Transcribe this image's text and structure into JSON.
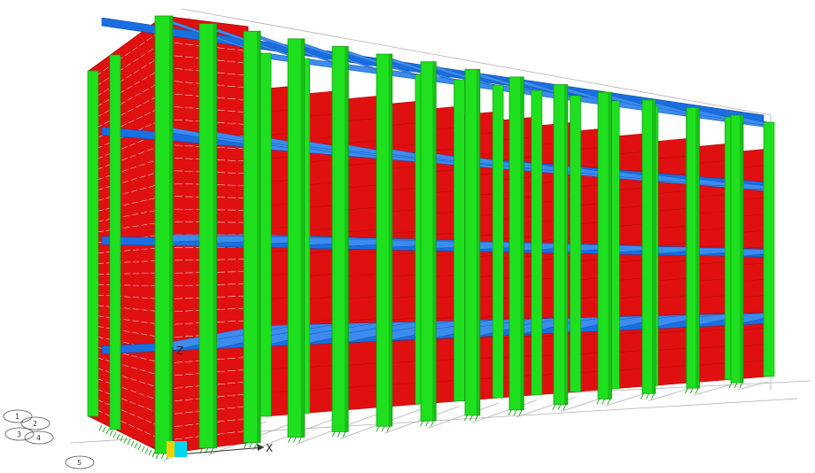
{
  "viewport": {
    "title": "",
    "background": "#ffffff"
  },
  "model": {
    "colors": {
      "columns": "#1fe01f",
      "column_dark": "#10a010",
      "beams": "#1a6ee0",
      "beams_light": "#3c8cf0",
      "walls": "#e01010",
      "wall_dark": "#b00808",
      "grid": "#b0b0b0",
      "supports": "#22aa22"
    },
    "stories": 4,
    "column_lines": 14
  },
  "axes": {
    "x_label": "X",
    "z_label": "Z",
    "origin_colors": [
      "#f0d000",
      "#00d8f0"
    ]
  },
  "grid_bubbles": [
    "1",
    "2",
    "3",
    "4",
    "5"
  ]
}
